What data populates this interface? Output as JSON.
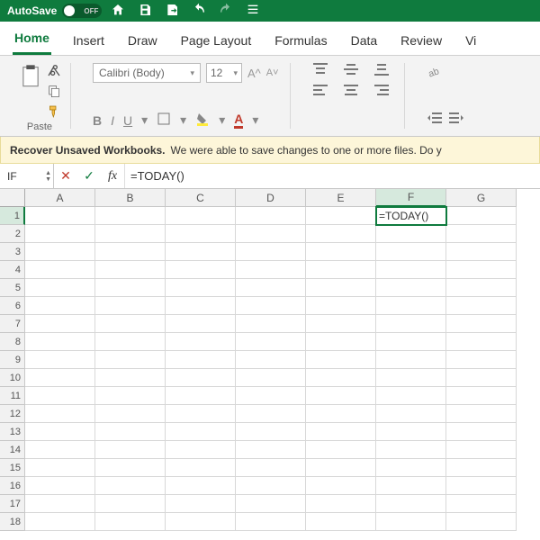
{
  "titlebar": {
    "autosave_label": "AutoSave",
    "autosave_state": "OFF"
  },
  "tabs": [
    "Home",
    "Insert",
    "Draw",
    "Page Layout",
    "Formulas",
    "Data",
    "Review",
    "Vi"
  ],
  "active_tab": "Home",
  "ribbon": {
    "paste_label": "Paste",
    "font_name": "Calibri (Body)",
    "font_size": "12",
    "bold": "B",
    "italic": "I",
    "underline": "U"
  },
  "recover": {
    "title": "Recover Unsaved Workbooks.",
    "msg": "We were able to save changes to one or more files. Do y"
  },
  "formula_bar": {
    "name_box": "IF",
    "fx": "fx",
    "formula": "=TODAY()"
  },
  "grid": {
    "columns": [
      "A",
      "B",
      "C",
      "D",
      "E",
      "F",
      "G"
    ],
    "rows": 18,
    "active_col": "F",
    "active_row": 1,
    "active_cell_value": "=TODAY()"
  }
}
